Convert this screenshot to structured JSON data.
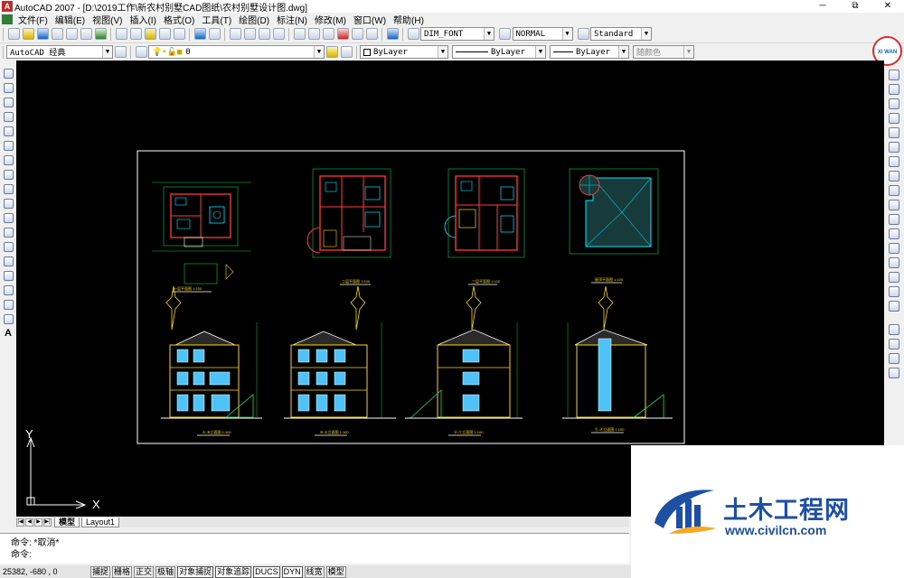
{
  "window": {
    "title": "AutoCAD 2007 - [D:\\2019工作\\新农村别墅CAD图纸\\农村别墅设计图.dwg]",
    "controls": [
      "─",
      "⧉",
      "✕"
    ]
  },
  "menu": [
    "文件(F)",
    "编辑(E)",
    "视图(V)",
    "插入(I)",
    "格式(O)",
    "工具(T)",
    "绘图(D)",
    "标注(N)",
    "修改(M)",
    "窗口(W)",
    "帮助(H)"
  ],
  "toolbar1": {
    "text_style": "DIM_FONT",
    "dim_style": "NORMAL",
    "table_style": "Standard"
  },
  "toolbar2": {
    "workspace": "AutoCAD 经典",
    "layer": "0",
    "color": "ByLayer",
    "linetype": "ByLayer",
    "lineweight": "ByLayer",
    "plot_style": "随颜色"
  },
  "logo_badge": "XI WAN",
  "canvas": {
    "ucs_y": "Y",
    "ucs_x": "X",
    "sheet_captions": [
      "一层平面图 1:100",
      "二层平面图 1:100",
      "三层平面图 1:100",
      "屋顶平面图 1:100",
      "①-⑧立面图 1:100",
      "⑧-①立面图 1:100",
      "Ⓐ-Ⓔ立面图 1:100",
      "Ⓔ-Ⓐ立面图 1:100"
    ]
  },
  "tabs": {
    "nav": [
      "|◀",
      "◀",
      "▶",
      "▶|"
    ],
    "model": "模型",
    "layout": "Layout1"
  },
  "command": {
    "line1": "命令: *取消*",
    "line2": "命令:"
  },
  "status": {
    "coords": "25382, -680 , 0",
    "buttons": [
      "捕捉",
      "栅格",
      "正交",
      "极轴",
      "对象捕捉",
      "对象追踪",
      "DUCS",
      "DYN",
      "线宽",
      "模型"
    ]
  },
  "watermark": {
    "title": "土木工程网",
    "url": "www.civilcn.com"
  }
}
